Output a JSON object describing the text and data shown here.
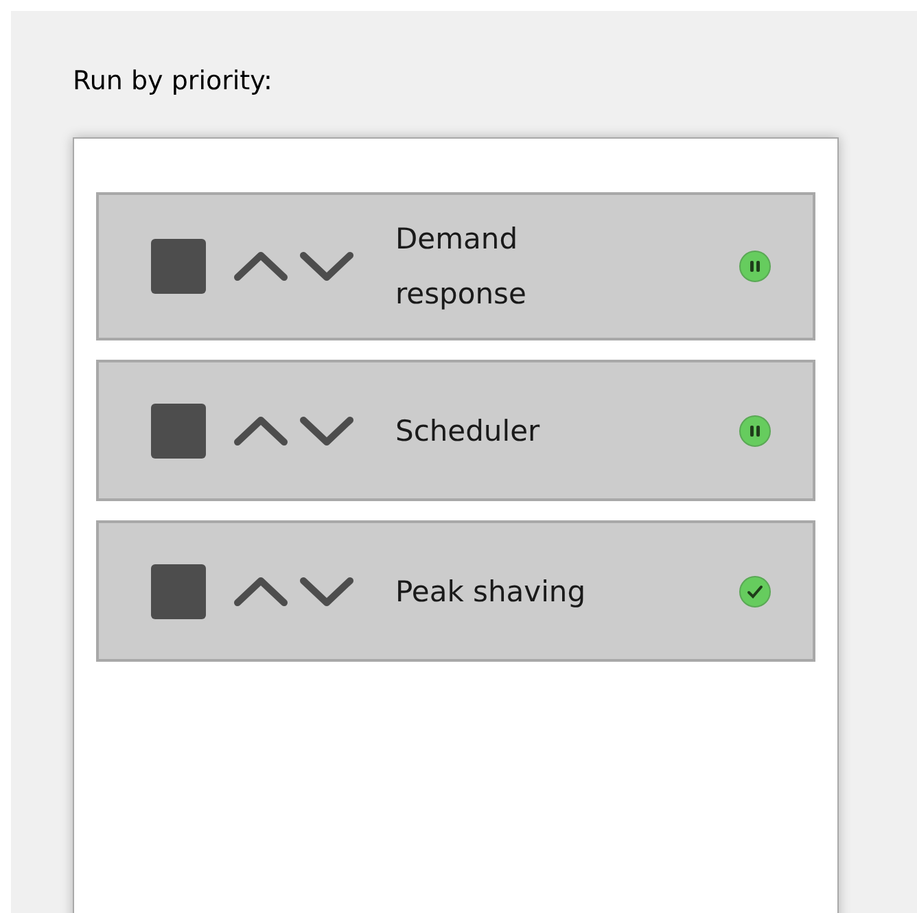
{
  "label": "Run by priority:",
  "items": [
    {
      "name": "Demand response",
      "kind": "paused"
    },
    {
      "name": "Scheduler",
      "kind": "paused"
    },
    {
      "name": "Peak shaving",
      "kind": "done"
    }
  ]
}
